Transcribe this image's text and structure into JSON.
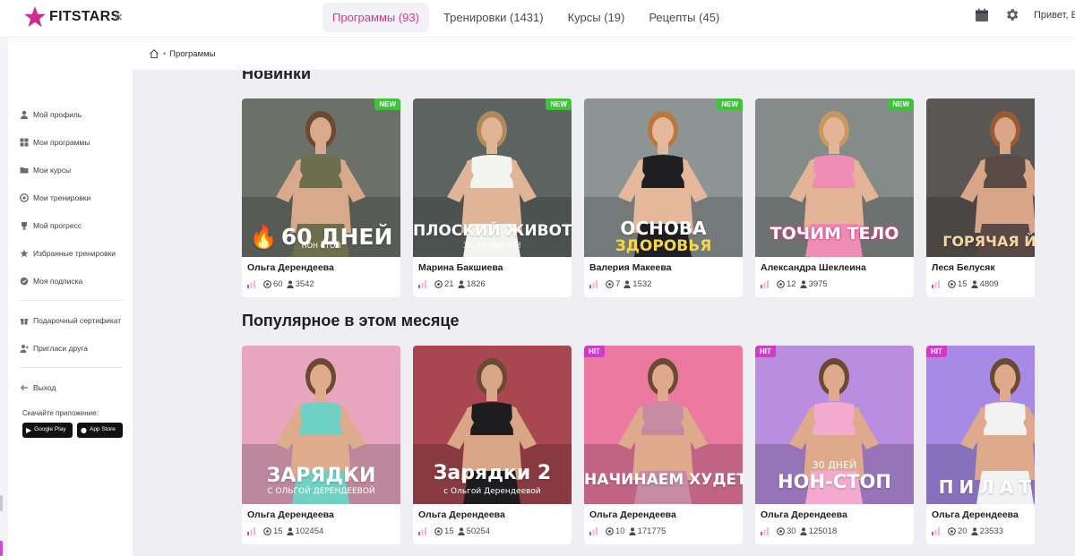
{
  "brand": {
    "name": "FITSTARS",
    "collapse_icon": "«"
  },
  "nav": {
    "tabs": [
      {
        "label": "Программы (93)",
        "active": true
      },
      {
        "label": "Тренировки (1431)",
        "active": false
      },
      {
        "label": "Курсы (19)",
        "active": false
      },
      {
        "label": "Рецепты (45)",
        "active": false
      }
    ],
    "greeting": "Привет, Ел"
  },
  "breadcrumb": {
    "current": "Программы"
  },
  "sidebar": {
    "menu": [
      {
        "label": "Мой профиль",
        "icon": "user-icon"
      },
      {
        "label": "Мои программы",
        "icon": "grid-icon"
      },
      {
        "label": "Мои курсы",
        "icon": "folder-icon"
      },
      {
        "label": "Мои тренировки",
        "icon": "dumbbell-icon"
      },
      {
        "label": "Мой прогресс",
        "icon": "trophy-icon"
      },
      {
        "label": "Избранные тренировки",
        "icon": "star-icon"
      },
      {
        "label": "Моя подписка",
        "icon": "ticket-icon"
      }
    ],
    "menu2": [
      {
        "label": "Подарочный сертификат",
        "icon": "gift-icon"
      },
      {
        "label": "Пригласи друга",
        "icon": "invite-icon"
      }
    ],
    "logout": {
      "label": "Выход",
      "icon": "exit-icon"
    },
    "app_label": "Скачайте приложение:",
    "stores": [
      {
        "label": "Google Play",
        "icon": "play-icon"
      },
      {
        "label": "App Store",
        "icon": "apple-icon"
      }
    ]
  },
  "sections": [
    {
      "title": "Новинки",
      "cards": [
        {
          "author": "Ольга Дерендеева",
          "workouts": "60",
          "users": "3542",
          "badge": "NEW",
          "overlay": "60 ДНЕЙ",
          "overlay_sub": "НОН СТОП",
          "overlay_prefix": "🔥",
          "bg": "#6b7068",
          "skin": "#d8a98a",
          "top": "#6c6e4c",
          "hair": "#6b4a34"
        },
        {
          "author": "Марина Бакшиева",
          "workouts": "21",
          "users": "1826",
          "badge": "NEW",
          "overlay": "ПЛОСКИЙ ЖИВОТ",
          "overlay_sub": "ЗА 15 МИНУТ!",
          "overlay_prefix": "",
          "bg": "#5c6462",
          "skin": "#e0b597",
          "top": "#f3f3ef",
          "hair": "#b08a5a"
        },
        {
          "author": "Валерия Макеева",
          "workouts": "7",
          "users": "1532",
          "badge": "NEW",
          "overlay": "ОСНОВА",
          "overlay_sub": "ЗДОРОВЬЯ",
          "overlay_prefix": "",
          "bg": "#8d9594",
          "skin": "#e6b89b",
          "top": "#1f1f22",
          "hair": "#b9783f"
        },
        {
          "author": "Александра Шеклеина",
          "workouts": "12",
          "users": "3975",
          "badge": "NEW",
          "overlay": "ТОЧИМ ТЕЛО",
          "overlay_sub": "",
          "overlay_prefix": "",
          "bg": "#848b89",
          "skin": "#e3b496",
          "top": "#f08db5",
          "hair": "#c7995f"
        },
        {
          "author": "Леся Белусяк",
          "workouts": "15",
          "users": "4809",
          "badge": "",
          "overlay": "ГОРЯЧАЯ ЙОГА",
          "overlay_sub": "",
          "overlay_prefix": "",
          "bg": "#5a5654",
          "skin": "#d9a588",
          "top": "#5a4a46",
          "hair": "#9a5a33"
        }
      ]
    },
    {
      "title": "Популярное в этом месяце",
      "cards": [
        {
          "author": "Ольга Дерендеева",
          "workouts": "15",
          "users": "102454",
          "badge": "",
          "overlay": "ЗАРЯДКИ",
          "overlay_sub": "С ОЛЬГОЙ ДЕРЕНДЕЕВОЙ",
          "overlay_prefix": "",
          "bg": "#e7a6bd",
          "skin": "#deac8d",
          "top": "#6fd1c4",
          "hair": "#6b4a34"
        },
        {
          "author": "Ольга Дерендеева",
          "workouts": "15",
          "users": "50254",
          "badge": "",
          "overlay": "Зарядки 2",
          "overlay_sub": "с Ольгой Дерендеевой",
          "overlay_prefix": "",
          "bg": "#a8474f",
          "skin": "#d9a688",
          "top": "#1d1d20",
          "hair": "#6b4a34"
        },
        {
          "author": "Ольга Дерендеева",
          "workouts": "10",
          "users": "171775",
          "badge": "HIT",
          "overlay": "НАЧИНАЕМ ХУДЕТЬ",
          "overlay_sub": "",
          "overlay_prefix": "",
          "bg": "#ec7aa0",
          "skin": "#deaa8b",
          "top": "#c68ba0",
          "hair": "#6b4a34"
        },
        {
          "author": "Ольга Дерендеева",
          "workouts": "30",
          "users": "125018",
          "badge": "HIT",
          "overlay": "НОН-СТОП",
          "overlay_sub": "30 ДНЕЙ",
          "overlay_prefix": "",
          "bg": "#b98ee0",
          "skin": "#deaa8b",
          "top": "#f4a9cf",
          "hair": "#6b4a34"
        },
        {
          "author": "Ольга Дерендеева",
          "workouts": "20",
          "users": "23533",
          "badge": "HIT",
          "overlay": "ПИЛАТЕС",
          "overlay_sub": "",
          "overlay_prefix": "",
          "bg": "#a78ae6",
          "skin": "#deaa8b",
          "top": "#f2f2f2",
          "hair": "#6b4a34"
        }
      ]
    }
  ],
  "colors": {
    "accent": "#d63a8d",
    "new_badge": "#3ec43a",
    "hit_badge": "#cf3cc6",
    "level_bar": "#e24aa0"
  }
}
